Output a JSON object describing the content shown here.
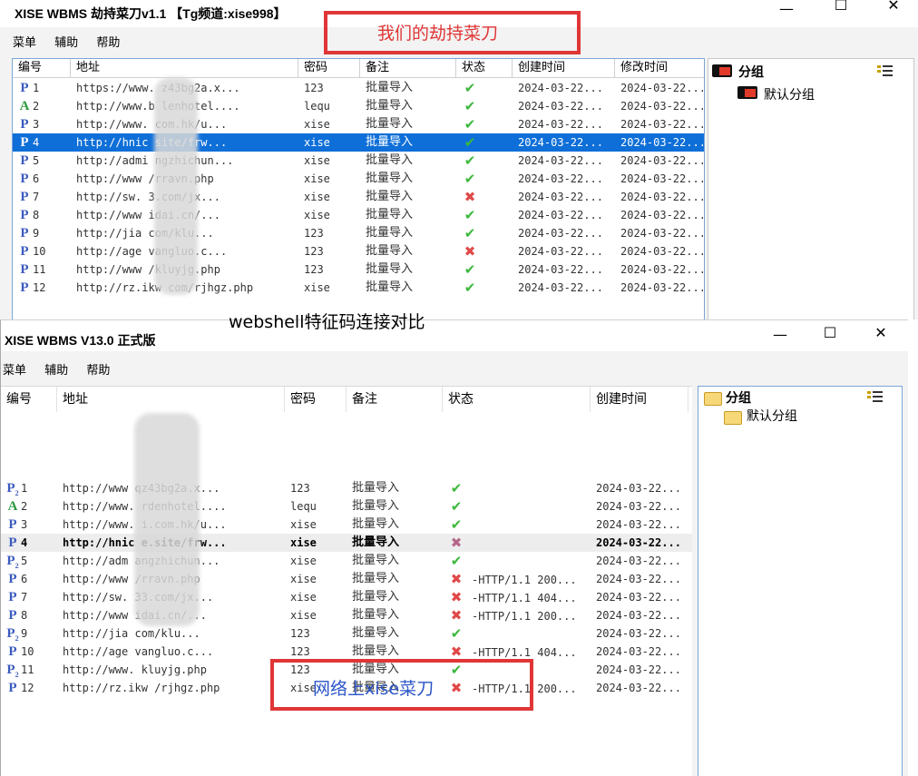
{
  "window1": {
    "title": "XISE WBMS 劫持菜刀v1.1 【Tg频道:xise998】",
    "controls": {
      "minimize": "—",
      "maximize": "☐",
      "close": "✕"
    },
    "menu": [
      "菜单",
      "辅助",
      "帮助"
    ],
    "columns": [
      "编号",
      "地址",
      "密码",
      "备注",
      "状态",
      "创建时间",
      "修改时间"
    ],
    "rows": [
      {
        "icon": "P",
        "id": "1",
        "url": "https://www.   z43bg2a.x...",
        "pwd": "123",
        "note": "批量导入",
        "ok": true,
        "created": "2024-03-22...",
        "modified": "2024-03-22..."
      },
      {
        "icon": "A",
        "id": "2",
        "url": "http://www.b    lenhotel....",
        "pwd": "lequ",
        "note": "批量导入",
        "ok": true,
        "created": "2024-03-22...",
        "modified": "2024-03-22..."
      },
      {
        "icon": "P",
        "id": "3",
        "url": "http://www.     com.hk/u...",
        "pwd": "xise",
        "note": "批量导入",
        "ok": true,
        "created": "2024-03-22...",
        "modified": "2024-03-22..."
      },
      {
        "icon": "P",
        "id": "4",
        "url": "http://hnic     site/frw...",
        "pwd": "xise",
        "note": "批量导入",
        "ok": true,
        "created": "2024-03-22...",
        "modified": "2024-03-22...",
        "selected": true
      },
      {
        "icon": "P",
        "id": "5",
        "url": "http://admi    ngzhichun...",
        "pwd": "xise",
        "note": "批量导入",
        "ok": true,
        "created": "2024-03-22...",
        "modified": "2024-03-22..."
      },
      {
        "icon": "P",
        "id": "6",
        "url": "http://www      /rravn.php",
        "pwd": "xise",
        "note": "批量导入",
        "ok": true,
        "created": "2024-03-22...",
        "modified": "2024-03-22..."
      },
      {
        "icon": "P",
        "id": "7",
        "url": "http://sw.      3.com/jx...",
        "pwd": "xise",
        "note": "批量导入",
        "ok": false,
        "created": "2024-03-22...",
        "modified": "2024-03-22..."
      },
      {
        "icon": "P",
        "id": "8",
        "url": "http://www     idai.cn/...",
        "pwd": "xise",
        "note": "批量导入",
        "ok": true,
        "created": "2024-03-22...",
        "modified": "2024-03-22..."
      },
      {
        "icon": "P",
        "id": "9",
        "url": "http://jia       com/klu...",
        "pwd": "123",
        "note": "批量导入",
        "ok": true,
        "created": "2024-03-22...",
        "modified": "2024-03-22..."
      },
      {
        "icon": "P",
        "id": "10",
        "url": "http://age     vangluo.c...",
        "pwd": "123",
        "note": "批量导入",
        "ok": false,
        "created": "2024-03-22...",
        "modified": "2024-03-22..."
      },
      {
        "icon": "P",
        "id": "11",
        "url": "http://www       /kluyjg.php",
        "pwd": "123",
        "note": "批量导入",
        "ok": true,
        "created": "2024-03-22...",
        "modified": "2024-03-22..."
      },
      {
        "icon": "P",
        "id": "12",
        "url": "http://rz.ikw     com/rjhgz.php",
        "pwd": "xise",
        "note": "批量导入",
        "ok": true,
        "created": "2024-03-22...",
        "modified": "2024-03-22..."
      }
    ],
    "tree": {
      "root": "分组",
      "child": "默认分组"
    }
  },
  "window2": {
    "title": "XISE WBMS V13.0 正式版",
    "controls": {
      "minimize": "—",
      "maximize": "☐",
      "close": "✕"
    },
    "menu": [
      "菜单",
      "辅助",
      "帮助"
    ],
    "columns": [
      "编号",
      "地址",
      "密码",
      "备注",
      "状态",
      "创建时间"
    ],
    "rows": [
      {
        "icon": "P2",
        "id": "1",
        "url": "http://www      qz43bg2a.x...",
        "pwd": "123",
        "note": "批量导入",
        "ok": true,
        "status": "",
        "created": "2024-03-22..."
      },
      {
        "icon": "A",
        "id": "2",
        "url": "http://www.     rdenhotel....",
        "pwd": "lequ",
        "note": "批量导入",
        "ok": true,
        "status": "",
        "created": "2024-03-22..."
      },
      {
        "icon": "P",
        "id": "3",
        "url": "http://www.     i.com.hk/u...",
        "pwd": "xise",
        "note": "批量导入",
        "ok": true,
        "status": "",
        "created": "2024-03-22..."
      },
      {
        "icon": "P",
        "id": "4",
        "url": "http://hnic     e.site/frw...",
        "pwd": "xise",
        "note": "批量导入",
        "ok": false,
        "status": "",
        "created": "2024-03-22...",
        "selected": true
      },
      {
        "icon": "P2",
        "id": "5",
        "url": "http://adm     angzhichun...",
        "pwd": "xise",
        "note": "批量导入",
        "ok": true,
        "status": "",
        "created": "2024-03-22..."
      },
      {
        "icon": "P",
        "id": "6",
        "url": "http://www      /rravn.php",
        "pwd": "xise",
        "note": "批量导入",
        "ok": false,
        "status": "-HTTP/1.1 200...",
        "created": "2024-03-22..."
      },
      {
        "icon": "P",
        "id": "7",
        "url": "http://sw.      33.com/jx...",
        "pwd": "xise",
        "note": "批量导入",
        "ok": false,
        "status": "-HTTP/1.1 404...",
        "created": "2024-03-22..."
      },
      {
        "icon": "P",
        "id": "8",
        "url": "http://www      idai.cn/...",
        "pwd": "xise",
        "note": "批量导入",
        "ok": false,
        "status": "-HTTP/1.1 200...",
        "created": "2024-03-22..."
      },
      {
        "icon": "P2",
        "id": "9",
        "url": "http://jia      com/klu...",
        "pwd": "123",
        "note": "批量导入",
        "ok": true,
        "status": "",
        "created": "2024-03-22..."
      },
      {
        "icon": "P",
        "id": "10",
        "url": "http://age     vangluo.c...",
        "pwd": "123",
        "note": "批量导入",
        "ok": false,
        "status": "-HTTP/1.1 404...",
        "created": "2024-03-22..."
      },
      {
        "icon": "P2",
        "id": "11",
        "url": "http://www.     kluyjg.php",
        "pwd": "123",
        "note": "批量导入",
        "ok": true,
        "status": "",
        "created": "2024-03-22..."
      },
      {
        "icon": "P",
        "id": "12",
        "url": "http://rz.ikw     /rjhgz.php",
        "pwd": "xise",
        "note": "批量导入",
        "ok": false,
        "status": "-HTTP/1.1 200...",
        "created": "2024-03-22..."
      }
    ],
    "tree": {
      "root": "分组",
      "child": "默认分组"
    }
  },
  "annotations": {
    "top_label": "我们的劫持菜刀",
    "middle_label": "webshell特征码连接对比",
    "bottom_label": "网络上xise菜刀",
    "box_color": "#e03636",
    "label_color": "#e03636",
    "bottom_label_color": "#2a55c8"
  },
  "colors": {
    "selection": "#0f6fd8",
    "ok": "#3cb83c",
    "fail": "#e04848"
  }
}
